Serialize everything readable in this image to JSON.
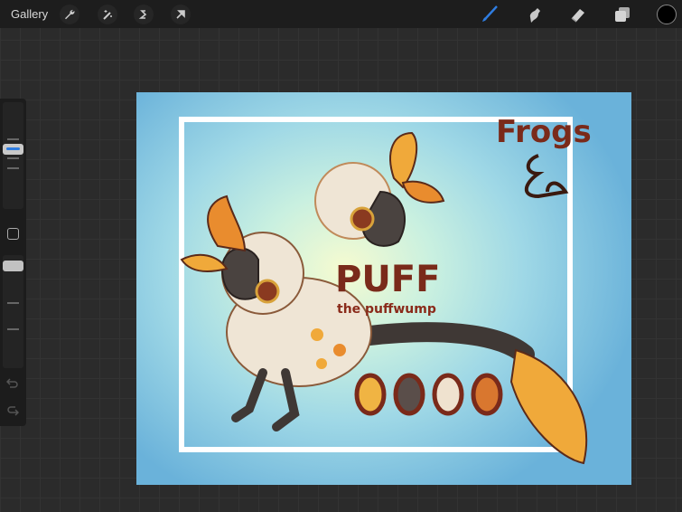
{
  "toolbar": {
    "gallery_label": "Gallery",
    "left_tools": [
      "wrench-icon",
      "magic-wand-icon",
      "selection-icon",
      "transform-arrow-icon"
    ],
    "right_tools": [
      "brush-icon",
      "smudge-icon",
      "eraser-icon",
      "layers-icon",
      "color-swatch"
    ],
    "active_tool": "brush",
    "current_color": "#000000",
    "accent": "#2f7de1"
  },
  "artwork": {
    "signature": "Frogs",
    "title": "PUFF",
    "subtitle": "the puffwump",
    "palette": [
      "#f0b443",
      "#5a4e4a",
      "#efe2cf",
      "#d9772f"
    ]
  }
}
